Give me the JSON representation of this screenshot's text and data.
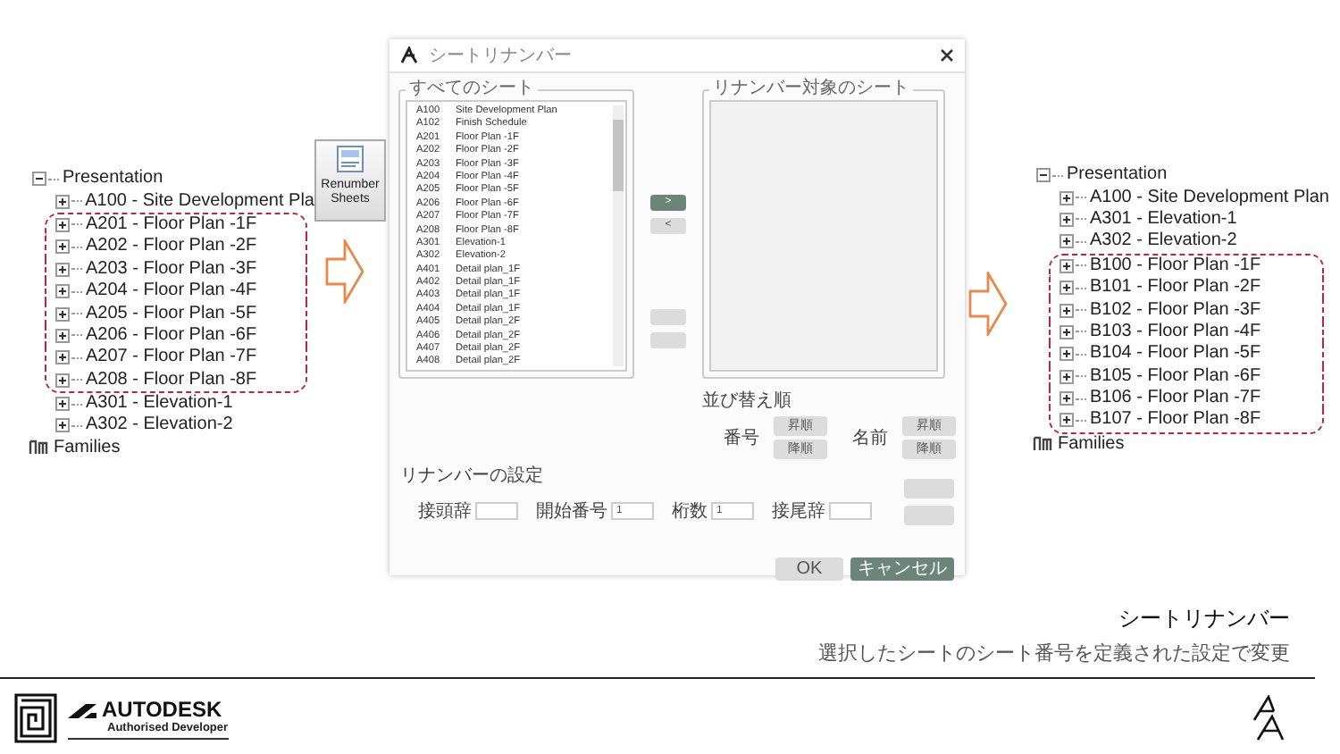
{
  "left_tree": {
    "items": [
      {
        "kind": "folder",
        "label": "Presentation",
        "expanded": true,
        "children": [
          {
            "label": "A100 - Site Development Pla",
            "expanded": false,
            "highlighted": false
          },
          {
            "label": "A201 - Floor Plan -1F",
            "expanded": false,
            "highlighted": true
          },
          {
            "label": "A202 - Floor Plan -2F",
            "expanded": false,
            "highlighted": true
          },
          {
            "label": "A203 - Floor Plan -3F",
            "expanded": false,
            "highlighted": true
          },
          {
            "label": "A204 - Floor Plan -4F",
            "expanded": false,
            "highlighted": true
          },
          {
            "label": "A205 - Floor Plan -5F",
            "expanded": false,
            "highlighted": true
          },
          {
            "label": "A206 - Floor Plan -6F",
            "expanded": false,
            "highlighted": true
          },
          {
            "label": "A207 - Floor Plan -7F",
            "expanded": false,
            "highlighted": true
          },
          {
            "label": "A208 - Floor Plan -8F",
            "expanded": false,
            "highlighted": true
          },
          {
            "label": "A301 - Elevation-1",
            "expanded": false,
            "highlighted": false
          },
          {
            "label": "A302 - Elevation-2",
            "expanded": false,
            "highlighted": false
          }
        ]
      },
      {
        "kind": "families",
        "label": "Families"
      }
    ]
  },
  "renumber_button": {
    "label": "Renumber Sheets"
  },
  "dialog": {
    "title": "シートリナンバー",
    "all_sheets": {
      "label": "すべてのシート",
      "rows": [
        {
          "number": "A100",
          "name": "Site Development Plan"
        },
        {
          "number": "A102",
          "name": "Finish Schedule"
        },
        {
          "number": "A201",
          "name": "Floor Plan -1F"
        },
        {
          "number": "A202",
          "name": "Floor Plan -2F"
        },
        {
          "number": "A203",
          "name": "Floor Plan -3F"
        },
        {
          "number": "A204",
          "name": "Floor Plan -4F"
        },
        {
          "number": "A205",
          "name": "Floor Plan -5F"
        },
        {
          "number": "A206",
          "name": "Floor Plan -6F"
        },
        {
          "number": "A207",
          "name": "Floor Plan -7F"
        },
        {
          "number": "A208",
          "name": "Floor Plan -8F"
        },
        {
          "number": "A301",
          "name": "Elevation-1"
        },
        {
          "number": "A302",
          "name": "Elevation-2"
        },
        {
          "number": "A401",
          "name": "Detail plan_1F"
        },
        {
          "number": "A402",
          "name": "Detail plan_1F"
        },
        {
          "number": "A403",
          "name": "Detail plan_1F"
        },
        {
          "number": "A404",
          "name": "Detail plan_1F"
        },
        {
          "number": "A405",
          "name": "Detail plan_2F"
        },
        {
          "number": "A406",
          "name": "Detail plan_2F"
        },
        {
          "number": "A407",
          "name": "Detail plan_2F"
        },
        {
          "number": "A408",
          "name": "Detail plan_2F"
        }
      ]
    },
    "transfer_buttons": [
      {
        "label": ">",
        "disabled": false
      },
      {
        "label": "<",
        "disabled": true
      },
      {
        "disabled": true
      },
      {
        "disabled": true
      }
    ],
    "target_sheets": {
      "label": "リナンバー対象のシート"
    },
    "sort": {
      "label": "並び替え順",
      "groups": [
        {
          "label": "番号",
          "buttons": [
            {
              "label": "昇順",
              "disabled": true
            },
            {
              "label": "降順",
              "disabled": true
            }
          ]
        },
        {
          "label": "名前",
          "buttons": [
            {
              "label": "昇順",
              "disabled": true
            },
            {
              "label": "降順",
              "disabled": true
            }
          ]
        }
      ]
    },
    "settings": {
      "label": "リナンバーの設定",
      "fields": [
        {
          "label": "接頭辞"
        },
        {
          "label": "開始番号",
          "value": "1"
        },
        {
          "label": "桁数",
          "value": "1"
        },
        {
          "label": "接尾辞"
        }
      ],
      "side_buttons": [
        {
          "disabled": true
        },
        {
          "disabled": true
        }
      ]
    },
    "footer_buttons": [
      {
        "label": "OK",
        "disabled": true
      },
      {
        "label": "キャンセル",
        "disabled": false
      }
    ]
  },
  "right_tree": {
    "items": [
      {
        "kind": "folder",
        "label": "Presentation",
        "expanded": true,
        "children": [
          {
            "label": "A100 - Site Development Plan",
            "expanded": false,
            "highlighted": false
          },
          {
            "label": "A301 - Elevation-1",
            "expanded": false,
            "highlighted": false
          },
          {
            "label": "A302 - Elevation-2",
            "expanded": false,
            "highlighted": false
          },
          {
            "label": "B100 - Floor Plan -1F",
            "expanded": false,
            "highlighted": true
          },
          {
            "label": "B101 - Floor Plan -2F",
            "expanded": false,
            "highlighted": true
          },
          {
            "label": "B102 - Floor Plan -3F",
            "expanded": false,
            "highlighted": true
          },
          {
            "label": "B103 - Floor Plan -4F",
            "expanded": false,
            "highlighted": true
          },
          {
            "label": "B104 - Floor Plan -5F",
            "expanded": false,
            "highlighted": true
          },
          {
            "label": "B105 - Floor Plan -6F",
            "expanded": false,
            "highlighted": true
          },
          {
            "label": "B106 - Floor Plan -7F",
            "expanded": false,
            "highlighted": true
          },
          {
            "label": "B107 - Floor Plan -8F",
            "expanded": false,
            "highlighted": true
          }
        ]
      },
      {
        "kind": "families",
        "label": "Families"
      }
    ]
  },
  "caption": {
    "title": "シートリナンバー",
    "description": "選択したシートのシート番号を定義された設定で変更"
  },
  "footer": {
    "brand": "AUTODESK",
    "subtitle": "Authorised Developer"
  }
}
